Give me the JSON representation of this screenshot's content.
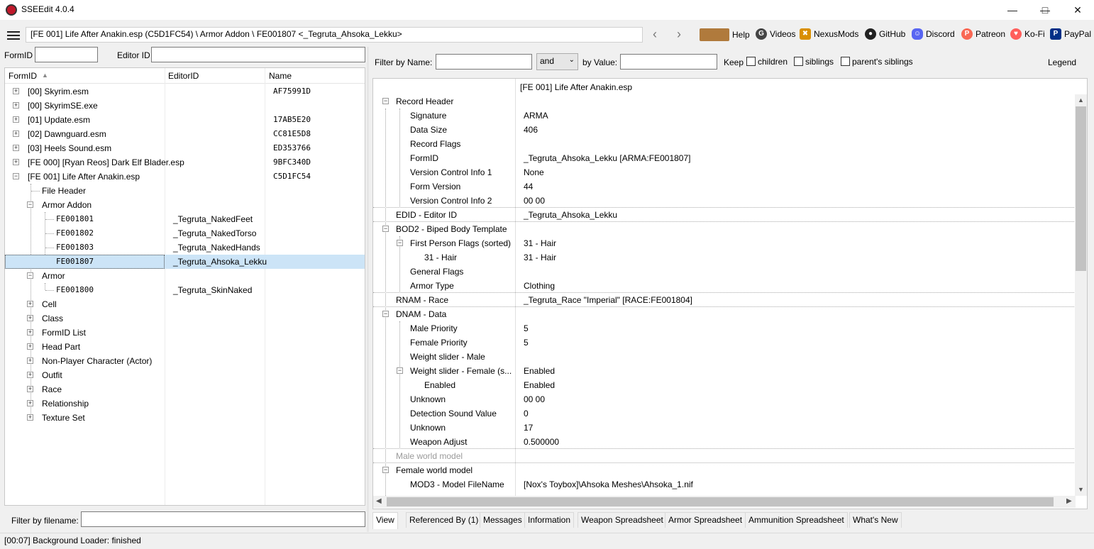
{
  "window": {
    "title": "SSEEdit 4.0.4"
  },
  "toolbar": {
    "path": "[FE 001] Life After Anakin.esp (C5D1FC54) \\ Armor Addon \\ FE001807 <_Tegruta_Ahsoka_Lekku>",
    "links": [
      {
        "label": "Help",
        "icon": "book-icon",
        "color": "#8b5a2b"
      },
      {
        "label": "Videos",
        "icon": "gp-icon",
        "color": "#333333"
      },
      {
        "label": "NexusMods",
        "icon": "nexus-icon",
        "color": "#d98f00"
      },
      {
        "label": "GitHub",
        "icon": "github-icon",
        "color": "#222222"
      },
      {
        "label": "Discord",
        "icon": "discord-icon",
        "color": "#5865f2"
      },
      {
        "label": "Patreon",
        "icon": "patreon-icon",
        "color": "#f96854"
      },
      {
        "label": "Ko-Fi",
        "icon": "kofi-icon",
        "color": "#ff5e5b"
      },
      {
        "label": "PayPal",
        "icon": "paypal-icon",
        "color": "#003087"
      }
    ]
  },
  "left": {
    "formid_label": "FormID",
    "editorid_label": "Editor ID",
    "columns": [
      "FormID",
      "EditorID",
      "Name"
    ],
    "filename_filter_label": "Filter by filename:"
  },
  "tree": [
    {
      "label": "[00] Skyrim.esm",
      "name": "AF75991D"
    },
    {
      "label": "[00] SkyrimSE.exe",
      "name": ""
    },
    {
      "label": "[01] Update.esm",
      "name": "17AB5E20"
    },
    {
      "label": "[02] Dawnguard.esm",
      "name": "CC81E5D8"
    },
    {
      "label": "[03] Heels Sound.esm",
      "name": "ED353766"
    },
    {
      "label": "[FE 000] [Ryan Reos] Dark Elf Blader.esp",
      "name": "9BFC340D"
    },
    {
      "label": "[FE 001] Life After Anakin.esp",
      "name": "C5D1FC54"
    },
    {
      "label": "File Header",
      "editorid": ""
    },
    {
      "label": "Armor Addon",
      "editorid": ""
    },
    {
      "label": "FE001801",
      "editorid": "_Tegruta_NakedFeet"
    },
    {
      "label": "FE001802",
      "editorid": "_Tegruta_NakedTorso"
    },
    {
      "label": "FE001803",
      "editorid": "_Tegruta_NakedHands"
    },
    {
      "label": "FE001807",
      "editorid": "_Tegruta_Ahsoka_Lekku"
    },
    {
      "label": "Armor",
      "editorid": ""
    },
    {
      "label": "FE001800",
      "editorid": "_Tegruta_SkinNaked"
    },
    {
      "label": "Cell"
    },
    {
      "label": "Class"
    },
    {
      "label": "FormID List"
    },
    {
      "label": "Head Part"
    },
    {
      "label": "Non-Player Character (Actor)"
    },
    {
      "label": "Outfit"
    },
    {
      "label": "Race"
    },
    {
      "label": "Relationship"
    },
    {
      "label": "Texture Set"
    }
  ],
  "filter": {
    "by_name_label": "Filter by Name:",
    "operator": "and",
    "by_value_label": "by Value:",
    "keep_label": "Keep",
    "children_label": "children",
    "siblings_label": "siblings",
    "parents_siblings_label": "parent's siblings",
    "legend_label": "Legend"
  },
  "view": {
    "header_value": "[FE 001] Life After Anakin.esp",
    "rows": [
      {
        "label": "Record Header",
        "value": ""
      },
      {
        "label": "Signature",
        "value": "ARMA"
      },
      {
        "label": "Data Size",
        "value": "406"
      },
      {
        "label": "Record Flags",
        "value": ""
      },
      {
        "label": "FormID",
        "value": "_Tegruta_Ahsoka_Lekku [ARMA:FE001807]"
      },
      {
        "label": "Version Control Info 1",
        "value": "None"
      },
      {
        "label": "Form Version",
        "value": "44"
      },
      {
        "label": "Version Control Info 2",
        "value": "00 00"
      },
      {
        "label": "EDID - Editor ID",
        "value": "_Tegruta_Ahsoka_Lekku"
      },
      {
        "label": "BOD2 - Biped Body Template",
        "value": ""
      },
      {
        "label": "First Person Flags (sorted)",
        "value": "31 - Hair"
      },
      {
        "label": "31 - Hair",
        "value": "31 - Hair"
      },
      {
        "label": "General Flags",
        "value": ""
      },
      {
        "label": "Armor Type",
        "value": "Clothing"
      },
      {
        "label": "RNAM - Race",
        "value": "_Tegruta_Race \"Imperial\" [RACE:FE001804]"
      },
      {
        "label": "DNAM - Data",
        "value": ""
      },
      {
        "label": "Male Priority",
        "value": "5"
      },
      {
        "label": "Female Priority",
        "value": "5"
      },
      {
        "label": "Weight slider - Male",
        "value": ""
      },
      {
        "label": "Weight slider - Female (s...",
        "value": "Enabled"
      },
      {
        "label": "Enabled",
        "value": "Enabled"
      },
      {
        "label": "Unknown",
        "value": "00 00"
      },
      {
        "label": "Detection Sound Value",
        "value": "0"
      },
      {
        "label": "Unknown",
        "value": "17"
      },
      {
        "label": "Weapon Adjust",
        "value": "0.500000"
      },
      {
        "label": "Male world model",
        "value": ""
      },
      {
        "label": "Female world model",
        "value": ""
      },
      {
        "label": "MOD3 - Model FileName",
        "value": "[Nox's Toybox]\\Ahsoka Meshes\\Ahsoka_1.nif"
      }
    ]
  },
  "tabs": [
    "View",
    "Referenced By (1)",
    "Messages",
    "Information",
    "Weapon Spreadsheet",
    "Armor Spreadsheet",
    "Ammunition Spreadsheet",
    "What's New"
  ],
  "status": "[00:07] Background Loader: finished"
}
